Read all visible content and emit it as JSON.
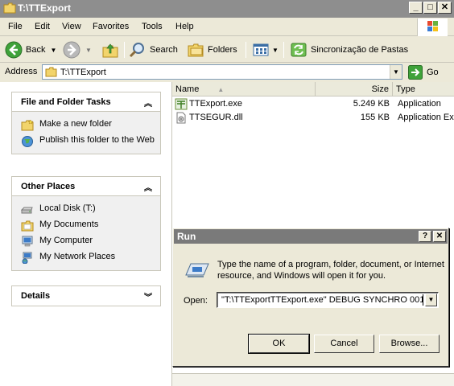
{
  "window": {
    "title": "T:\\TTExport"
  },
  "menu": [
    "File",
    "Edit",
    "View",
    "Favorites",
    "Tools",
    "Help"
  ],
  "toolbar": {
    "back": "Back",
    "search": "Search",
    "folders": "Folders",
    "sync": "Sincronização de Pastas"
  },
  "address": {
    "label": "Address",
    "value": "T:\\TTExport",
    "go": "Go"
  },
  "left": {
    "tasks": {
      "title": "File and Folder Tasks",
      "items": [
        "Make a new folder",
        "Publish this folder to the Web"
      ]
    },
    "places": {
      "title": "Other Places",
      "items": [
        "Local Disk (T:)",
        "My Documents",
        "My Computer",
        "My Network Places"
      ]
    },
    "details": {
      "title": "Details"
    }
  },
  "list": {
    "columns": [
      "Name",
      "Size",
      "Type"
    ],
    "rows": [
      {
        "name": "TTExport.exe",
        "size": "5.249 KB",
        "type": "Application"
      },
      {
        "name": "TTSEGUR.dll",
        "size": "155 KB",
        "type": "Application Ex"
      }
    ]
  },
  "run": {
    "title": "Run",
    "message": "Type the name of a program, folder, document, or Internet resource, and Windows will open it for you.",
    "open_label": "Open:",
    "command": "\"T:\\TTExportTTExport.exe\" DEBUG SYNCHRO 001",
    "ok": "OK",
    "cancel": "Cancel",
    "browse": "Browse..."
  }
}
